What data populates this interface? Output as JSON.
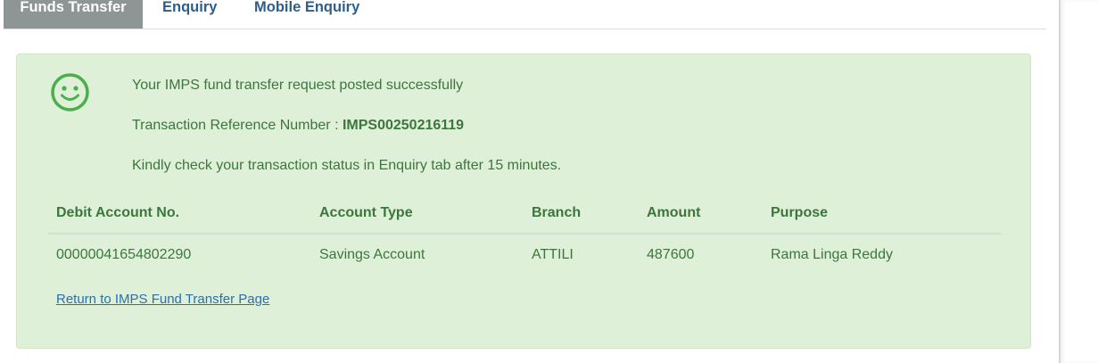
{
  "tabs": [
    {
      "label": "Funds Transfer",
      "active": true
    },
    {
      "label": "Enquiry",
      "active": false
    },
    {
      "label": "Mobile Enquiry",
      "active": false
    }
  ],
  "status": {
    "icon": "smiley-icon",
    "message": "Your IMPS fund transfer request posted successfully",
    "reference_label": "Transaction Reference Number : ",
    "reference_number": "IMPS00250216119",
    "note": "Kindly check your transaction status in Enquiry tab after 15 minutes."
  },
  "table": {
    "headers": [
      "Debit Account No.",
      "Account Type",
      "Branch",
      "Amount",
      "Purpose"
    ],
    "rows": [
      [
        "00000041654802290",
        "Savings Account",
        "ATTILI",
        "487600",
        "Rama Linga Reddy"
      ]
    ]
  },
  "return_link": "Return to IMPS Fund Transfer Page",
  "colors": {
    "success_bg": "#dff0d8",
    "success_text": "#3c763d",
    "active_tab_bg": "#8d9694",
    "link": "#2a6fb0"
  }
}
